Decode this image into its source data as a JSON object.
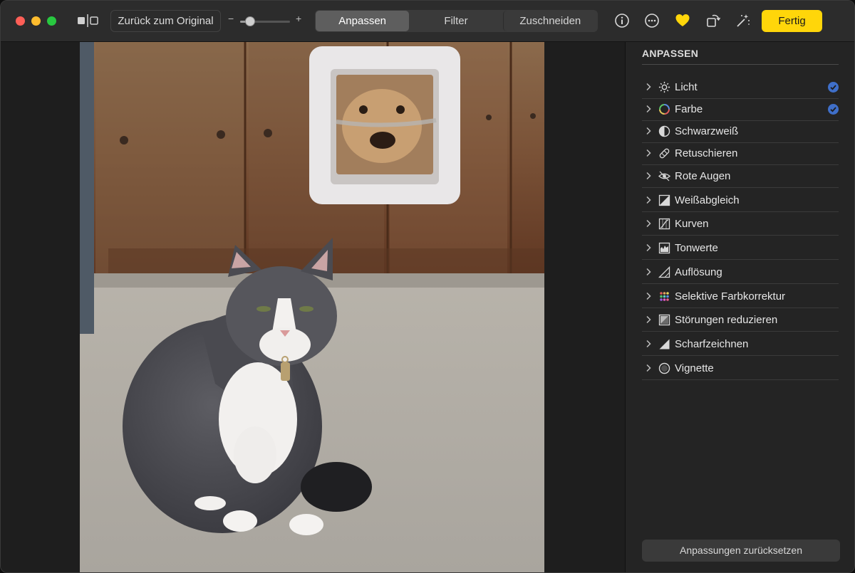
{
  "toolbar": {
    "revert_label": "Zurück zum Original",
    "zoom_minus": "−",
    "zoom_plus": "+",
    "zoom_level": 0.2,
    "tabs": [
      {
        "label": "Anpassen",
        "active": true
      },
      {
        "label": "Filter",
        "active": false
      },
      {
        "label": "Zuschneiden",
        "active": false
      }
    ],
    "icons": [
      "info-icon",
      "more-icon",
      "favorite-heart-icon",
      "rotate-icon",
      "auto-enhance-icon"
    ],
    "done_label": "Fertig",
    "accent_color": "#ffd60a"
  },
  "sidebar": {
    "title": "ANPASSEN",
    "items": [
      {
        "label": "Licht",
        "icon": "sun-icon",
        "checked": true
      },
      {
        "label": "Farbe",
        "icon": "color-ring-icon",
        "checked": true
      },
      {
        "label": "Schwarzweiß",
        "icon": "half-circle-icon",
        "checked": false
      },
      {
        "label": "Retuschieren",
        "icon": "bandage-icon",
        "checked": false
      },
      {
        "label": "Rote Augen",
        "icon": "eye-icon",
        "checked": false
      },
      {
        "label": "Weißabgleich",
        "icon": "white-balance-icon",
        "checked": false
      },
      {
        "label": "Kurven",
        "icon": "curves-icon",
        "checked": false
      },
      {
        "label": "Tonwerte",
        "icon": "levels-icon",
        "checked": false
      },
      {
        "label": "Auflösung",
        "icon": "definition-icon",
        "checked": false
      },
      {
        "label": "Selektive Farbkorrektur",
        "icon": "selective-color-icon",
        "checked": false
      },
      {
        "label": "Störungen reduzieren",
        "icon": "noise-icon",
        "checked": false
      },
      {
        "label": "Scharfzeichnen",
        "icon": "sharpen-icon",
        "checked": false
      },
      {
        "label": "Vignette",
        "icon": "vignette-icon",
        "checked": false
      }
    ],
    "check_color": "#3f6fc9",
    "reset_label": "Anpassungen zurücksetzen"
  }
}
